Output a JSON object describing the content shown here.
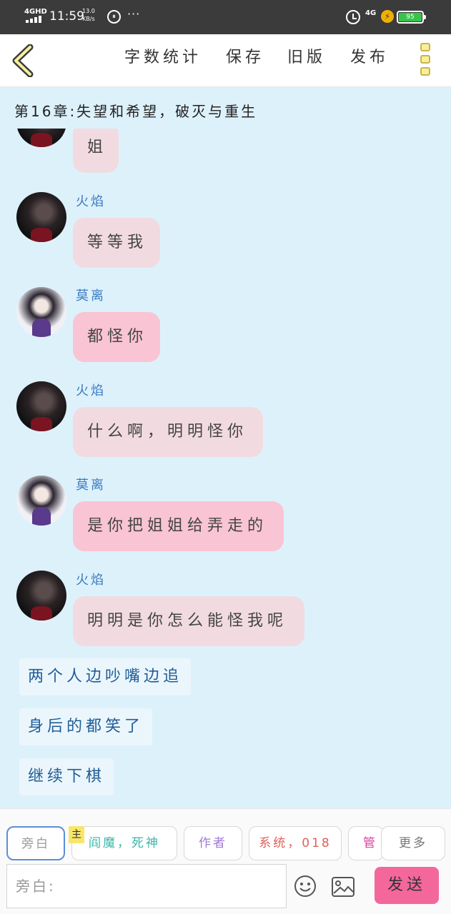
{
  "status_bar": {
    "network_label": "4GHD",
    "time": "11:59",
    "speed_value": "13.0",
    "speed_unit": "KB/s",
    "more_label": "···",
    "net_type": "4G",
    "battery_level": "95",
    "battery_color": "#36c54a"
  },
  "header": {
    "menu": [
      "字数统计",
      "保存",
      "旧版",
      "发布"
    ]
  },
  "chapter_title": "第16章:失望和希望，破灭与重生",
  "messages": [
    {
      "speaker": "",
      "text": "姐"
    },
    {
      "speaker": "火焰",
      "text": "等等我"
    },
    {
      "speaker": "莫离",
      "text": "都怪你"
    },
    {
      "speaker": "火焰",
      "text": "什么啊，明明怪你"
    },
    {
      "speaker": "莫离",
      "text": "是你把姐姐给弄走的"
    },
    {
      "speaker": "火焰",
      "text": "明明是你怎么能怪我呢"
    }
  ],
  "narration": [
    "两个人边吵嘴边追",
    "身后的都笑了",
    "继续下棋"
  ],
  "roles": [
    "旁白",
    "阎魔，死神",
    "作者",
    "系统，018",
    "管",
    "更多"
  ],
  "role_badge": "主",
  "role_colors": {
    "narrator": "#999999",
    "yanmo": "#3bb6a8",
    "author": "#a07ad6",
    "system": "#e0605a",
    "admin": "#d6409b",
    "more": "#777777"
  },
  "input": {
    "placeholder": "旁白:"
  },
  "send_label": "发送",
  "accent_color": "#f4679b"
}
